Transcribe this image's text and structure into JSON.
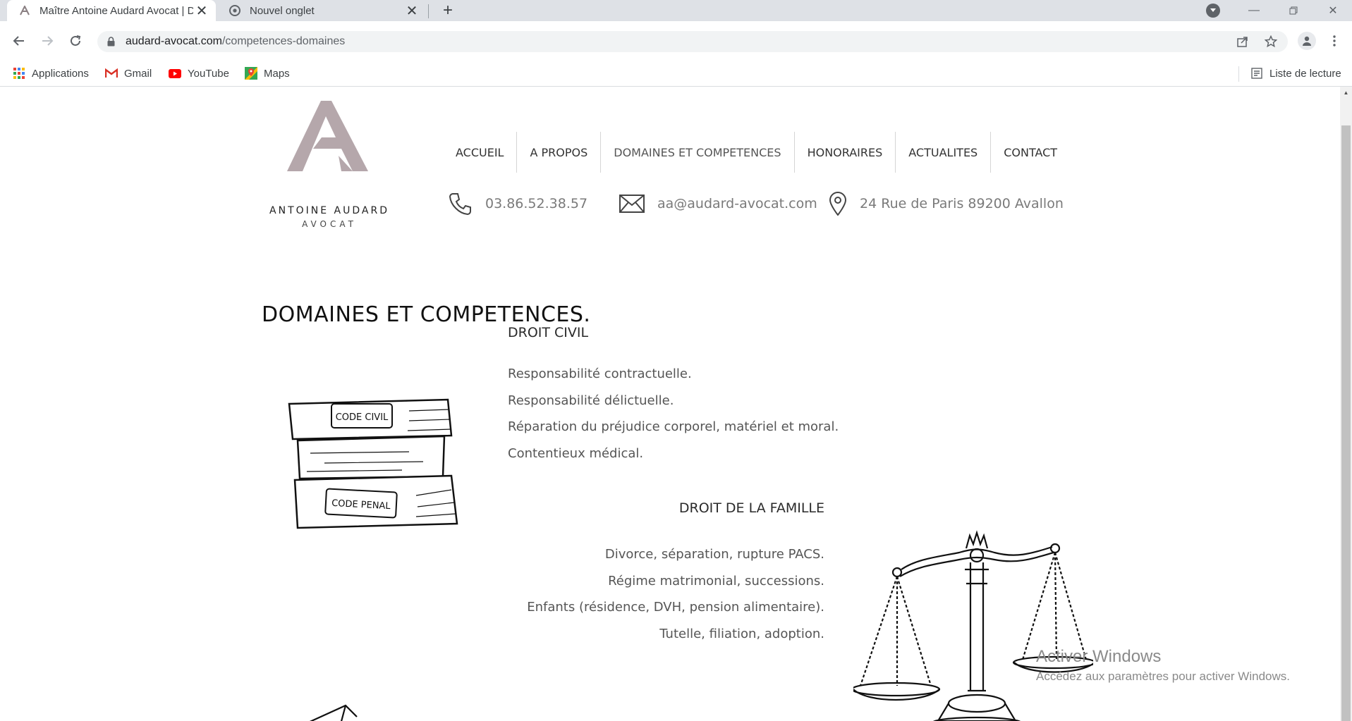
{
  "browser": {
    "tabs": [
      {
        "title": "Maître Antoine Audard Avocat | D",
        "active": true
      },
      {
        "title": "Nouvel onglet",
        "active": false
      }
    ],
    "url_domain": "audard-avocat.com",
    "url_path": "/competences-domaines",
    "bookmarks": [
      {
        "label": "Applications",
        "icon": "apps-grid-icon"
      },
      {
        "label": "Gmail",
        "icon": "gmail-icon"
      },
      {
        "label": "YouTube",
        "icon": "youtube-icon"
      },
      {
        "label": "Maps",
        "icon": "maps-icon"
      }
    ],
    "reading_list": "Liste de lecture"
  },
  "site": {
    "logo": {
      "name": "ANTOINE AUDARD",
      "sub": "AVOCAT",
      "color": "#b5a7ab"
    },
    "nav": [
      "ACCUEIL",
      "A PROPOS",
      "DOMAINES ET COMPETENCES",
      "HONORAIRES",
      "ACTUALITES",
      "CONTACT"
    ],
    "contact": {
      "phone": "03.86.52.38.57",
      "email": "aa@audard-avocat.com",
      "address": "24 Rue de Paris 89200 Avallon"
    },
    "page_title": "DOMAINES ET COMPETENCES.",
    "sections": [
      {
        "title": "DROIT CIVIL",
        "items": [
          "Responsabilité contractuelle.",
          "Responsabilité délictuelle.",
          "Réparation du préjudice corporel, matériel et moral.",
          "Contentieux médical."
        ]
      },
      {
        "title": "DROIT DE LA FAMILLE",
        "items": [
          "Divorce, séparation, rupture PACS.",
          "Régime matrimonial, successions.",
          "Enfants (résidence, DVH, pension alimentaire).",
          "Tutelle, filiation, adoption."
        ]
      }
    ],
    "book_labels": [
      "CODE CIVIL",
      "CODE PENAL"
    ]
  },
  "watermark": {
    "title": "Activer Windows",
    "subtitle": "Accédez aux paramètres pour activer Windows."
  }
}
